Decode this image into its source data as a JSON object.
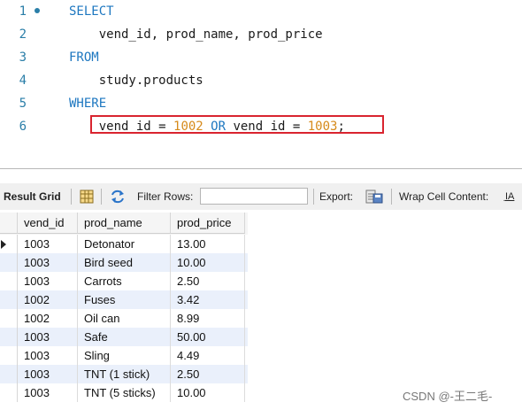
{
  "editor": {
    "lines": [
      {
        "num": "1",
        "parts": [
          {
            "t": "SELECT",
            "c": "kw"
          }
        ]
      },
      {
        "num": "2",
        "parts": [
          {
            "t": "    vend_id, prod_name, prod_price",
            "c": "ident"
          }
        ]
      },
      {
        "num": "3",
        "parts": [
          {
            "t": "FROM",
            "c": "kw"
          }
        ]
      },
      {
        "num": "4",
        "parts": [
          {
            "t": "    study.products",
            "c": "ident"
          }
        ]
      },
      {
        "num": "5",
        "parts": [
          {
            "t": "WHERE",
            "c": "kw"
          }
        ]
      },
      {
        "num": "6",
        "parts": [
          {
            "t": "    vend_id = ",
            "c": "ident"
          },
          {
            "t": "1002",
            "c": "num"
          },
          {
            "t": " OR ",
            "c": "kw"
          },
          {
            "t": "vend_id = ",
            "c": "ident"
          },
          {
            "t": "1003",
            "c": "num"
          },
          {
            "t": ";",
            "c": "ident"
          }
        ]
      }
    ]
  },
  "toolbar": {
    "result_grid_label": "Result Grid",
    "filter_rows_label": "Filter Rows:",
    "filter_rows_value": "",
    "export_label": "Export:",
    "wrap_label": "Wrap Cell Content:",
    "wrap_icon_glyph": "I̲A"
  },
  "grid": {
    "columns": [
      "vend_id",
      "prod_name",
      "prod_price"
    ],
    "rows": [
      [
        "1003",
        "Detonator",
        "13.00"
      ],
      [
        "1003",
        "Bird seed",
        "10.00"
      ],
      [
        "1003",
        "Carrots",
        "2.50"
      ],
      [
        "1002",
        "Fuses",
        "3.42"
      ],
      [
        "1002",
        "Oil can",
        "8.99"
      ],
      [
        "1003",
        "Safe",
        "50.00"
      ],
      [
        "1003",
        "Sling",
        "4.49"
      ],
      [
        "1003",
        "TNT (1 stick)",
        "2.50"
      ],
      [
        "1003",
        "TNT (5 sticks)",
        "10.00"
      ]
    ]
  },
  "watermark": "CSDN @-王二毛-",
  "colors": {
    "keyword": "#1d77c0",
    "number": "#d68a1b",
    "highlight_box": "#d9242f",
    "alt_row": "#eaf0fb"
  }
}
